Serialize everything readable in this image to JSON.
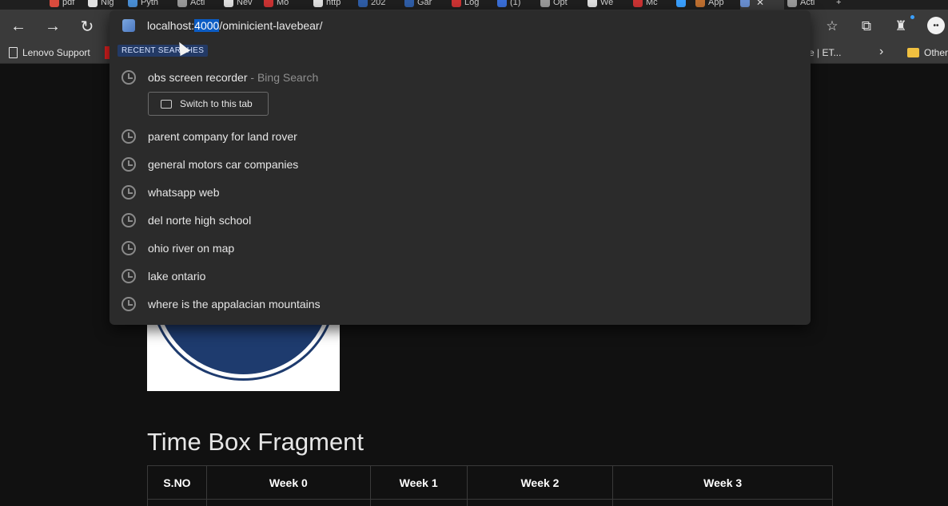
{
  "tabs": [
    {
      "title": "pdf",
      "color": "#d94b3d"
    },
    {
      "title": "Nig",
      "color": "#e0e0e0"
    },
    {
      "title": "Pyth",
      "color": "#4a8fd6"
    },
    {
      "title": "Acti",
      "color": "#9a9a9a"
    },
    {
      "title": "Nev",
      "color": "#e0e0e0"
    },
    {
      "title": "Mo",
      "color": "#c33"
    },
    {
      "title": "http",
      "color": "#e0e0e0"
    },
    {
      "title": "202",
      "color": "#2f5ea8"
    },
    {
      "title": "Gar",
      "color": "#2f5ea8"
    },
    {
      "title": "Log",
      "color": "#c33"
    },
    {
      "title": "(1)",
      "color": "#3a6fd8"
    },
    {
      "title": "Opt",
      "color": "#9a9a9a"
    },
    {
      "title": "We",
      "color": "#e0e0e0"
    },
    {
      "title": "Mc",
      "color": "#c33"
    },
    {
      "title": "",
      "color": "#3aa0ff"
    },
    {
      "title": "App",
      "color": "#c07030"
    },
    {
      "title": "",
      "color": "#6a8fd0"
    },
    {
      "title": "Acti",
      "color": "#9a9a9a"
    }
  ],
  "tab_close": "✕",
  "new_tab": "+",
  "toolbar": {
    "back": "←",
    "forward": "→",
    "refresh": "↻",
    "favorites_icon": "☆",
    "collections_icon": "⧉",
    "extensions_icon": "♜",
    "profile_initial": "••"
  },
  "favorites": {
    "lenovo_support": "Lenovo Support",
    "et_item": "e | ET...",
    "other": "Other",
    "more": "›"
  },
  "omnibox": {
    "address_prefix": "localhost:",
    "address_selected": "4000",
    "address_suffix": "/ominicient-lavebear/",
    "section_label": "RECENT SEARCHES",
    "switch_tab_label": "Switch to this tab",
    "suggestions": [
      {
        "text": "obs screen recorder",
        "suffix": "- Bing Search"
      },
      {
        "text": "parent company for land rover"
      },
      {
        "text": "general motors car companies"
      },
      {
        "text": "whatsapp web"
      },
      {
        "text": "del norte high school"
      },
      {
        "text": "ohio river on map"
      },
      {
        "text": "lake ontario"
      },
      {
        "text": "where is the appalacian mountains"
      }
    ]
  },
  "page": {
    "heading": "Time Box Fragment",
    "table_headers": [
      "S.NO",
      "Week 0",
      "Week 1",
      "Week 2",
      "Week 3"
    ]
  }
}
